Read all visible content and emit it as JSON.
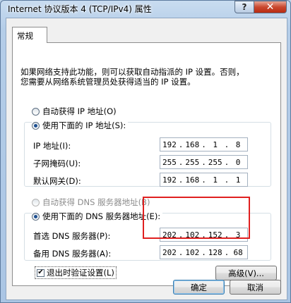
{
  "window": {
    "title": "Internet 协议版本 4 (TCP/IPv4) 属性",
    "help_glyph": "?",
    "close_glyph": "✕"
  },
  "tab": {
    "label": "常规"
  },
  "description": [
    "如果网络支持此功能，则可以获取自动指派的 IP 设置。否则，",
    "您需要从网络系统管理员处获得适当的 IP 设置。"
  ],
  "ip_section": {
    "auto_label": "自动获得 IP 地址(O)",
    "manual_label": "使用下面的 IP 地址(S):",
    "selected": "manual",
    "fields": [
      {
        "label": "IP 地址(I):",
        "octets": [
          "192",
          "168",
          "1",
          "8"
        ]
      },
      {
        "label": "子网掩码(U):",
        "octets": [
          "255",
          "255",
          "255",
          "0"
        ]
      },
      {
        "label": "默认网关(D):",
        "octets": [
          "192",
          "168",
          "1",
          "1"
        ]
      }
    ]
  },
  "dns_section": {
    "auto_label": "自动获得 DNS 服务器地址(B)",
    "manual_label": "使用下面的 DNS 服务器地址(E):",
    "selected": "manual",
    "fields": [
      {
        "label": "首选 DNS 服务器(P):",
        "octets": [
          "202",
          "102",
          "152",
          "3"
        ]
      },
      {
        "label": "备用 DNS 服务器(A):",
        "octets": [
          "202",
          "102",
          "128",
          "68"
        ]
      }
    ],
    "highlight_color": "#e02020"
  },
  "validate": {
    "label": "退出时验证设置(L)",
    "checked": true,
    "check_glyph": "✔"
  },
  "buttons": {
    "advanced": "高级(V)...",
    "ok": "确定",
    "cancel": "取消"
  },
  "colors": {
    "title_bar": "#b4cde8",
    "close_button": "#c9482f",
    "highlight": "#e02020"
  }
}
